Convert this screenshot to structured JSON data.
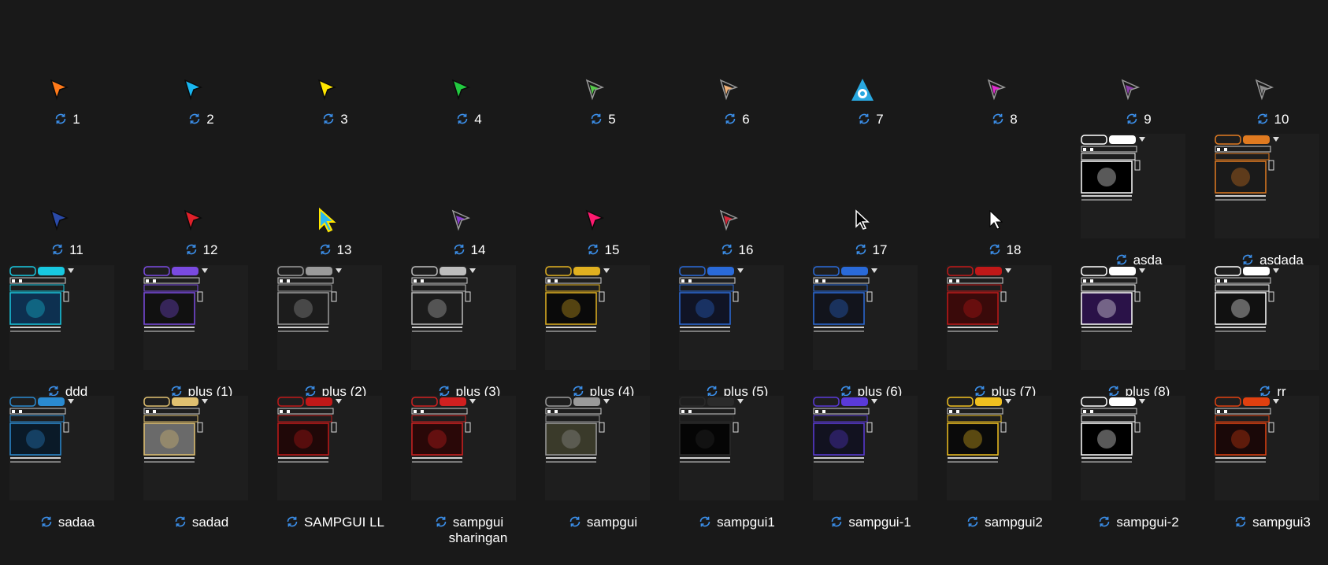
{
  "folder": {
    "cursor_files": [
      {
        "name": "1",
        "icon": "orange-arrow-cursor-icon",
        "color": "#ff7a1a"
      },
      {
        "name": "2",
        "icon": "cyan-arrow-cursor-icon",
        "color": "#19b6f0"
      },
      {
        "name": "3",
        "icon": "yellow-arrow-cursor-icon",
        "color": "#ffe600"
      },
      {
        "name": "4",
        "icon": "green-arrow-cursor-icon",
        "color": "#22c940"
      },
      {
        "name": "5",
        "icon": "green-outline-arrow-cursor-icon",
        "color": "#55c94a"
      },
      {
        "name": "6",
        "icon": "peach-outline-arrow-cursor-icon",
        "color": "#f0b27a"
      },
      {
        "name": "7",
        "icon": "blue-triangle-cursor-icon",
        "color": "#29a8e0"
      },
      {
        "name": "8",
        "icon": "magenta-outline-arrow-cursor-icon",
        "color": "#e02bd0"
      },
      {
        "name": "9",
        "icon": "purple-red-outline-arrow-cursor-icon",
        "color": "#8a3fa8"
      },
      {
        "name": "10",
        "icon": "gray-outline-arrow-cursor-icon",
        "color": "#8c8c8c"
      },
      {
        "name": "11",
        "icon": "navy-arrow-cursor-icon",
        "color": "#2a4aa8"
      },
      {
        "name": "12",
        "icon": "red-arrow-cursor-icon",
        "color": "#e0202a"
      },
      {
        "name": "13",
        "icon": "cyan-yellow-arrow-cursor-icon",
        "color": "#2ab8f0"
      },
      {
        "name": "14",
        "icon": "purple-outline-arrow-cursor-icon",
        "color": "#8a3fd0"
      },
      {
        "name": "15",
        "icon": "pink-arrow-cursor-icon",
        "color": "#ff1a70"
      },
      {
        "name": "16",
        "icon": "red-outline-arrow-cursor-icon",
        "color": "#d8283a"
      },
      {
        "name": "17",
        "icon": "black-arrow-cursor-icon",
        "color": "#000000"
      },
      {
        "name": "18",
        "icon": "white-arrow-cursor-icon",
        "color": "#ffffff"
      }
    ],
    "theme_files": [
      {
        "name": "asda",
        "icon": "eye-of-sauron-thumbnail",
        "accent": "#ffffff",
        "bg": "#000000"
      },
      {
        "name": "asdada",
        "icon": "orange-tiger-thumbnail",
        "accent": "#e07a20",
        "bg": "#1a1a1a"
      },
      {
        "name": "ddd",
        "icon": "cyan-smoke-thumbnail",
        "accent": "#18c8e0",
        "bg": "#0d3050"
      },
      {
        "name": "plus (1)",
        "icon": "purple-theme-thumbnail",
        "accent": "#7a4ae0",
        "bg": "#111111"
      },
      {
        "name": "plus (2)",
        "icon": "gray-theme-thumbnail",
        "accent": "#9a9a9a",
        "bg": "#1c1c1c"
      },
      {
        "name": "plus (3)",
        "icon": "silver-theme-thumbnail",
        "accent": "#bdbdbd",
        "bg": "#1c1c1c"
      },
      {
        "name": "plus (4)",
        "icon": "rockstar-theme-thumbnail",
        "accent": "#e0b020",
        "bg": "#0a0a0a"
      },
      {
        "name": "plus (5)",
        "icon": "blue-theme-thumbnail",
        "accent": "#2a6ad8",
        "bg": "#101425"
      },
      {
        "name": "plus (6)",
        "icon": "blue-dark-theme-thumbnail",
        "accent": "#2a6ad8",
        "bg": "#12141c"
      },
      {
        "name": "plus (7)",
        "icon": "skull-theme-thumbnail",
        "accent": "#c01818",
        "bg": "#3a0a0a"
      },
      {
        "name": "plus (8)",
        "icon": "purple-fighter-thumbnail",
        "accent": "#ffffff",
        "bg": "#2a1248"
      },
      {
        "name": "rr",
        "icon": "punisher-theme-thumbnail",
        "accent": "#ffffff",
        "bg": "#111111"
      },
      {
        "name": "sadaa",
        "icon": "joker-theme-thumbnail",
        "accent": "#2a8ad0",
        "bg": "#0a1a28"
      },
      {
        "name": "sadad",
        "icon": "gold-theme-thumbnail",
        "accent": "#e0c070",
        "bg": "#6a6a6a"
      },
      {
        "name": "SAMPGUI LL",
        "icon": "red-ll-theme-thumbnail",
        "accent": "#c01818",
        "bg": "#200808"
      },
      {
        "name": "sampgui sharingan",
        "icon": "sharingan-theme-thumbnail",
        "accent": "#d02020",
        "bg": "#2a0808"
      },
      {
        "name": "sampgui",
        "icon": "troll-face-theme-thumbnail",
        "accent": "#9a9a9a",
        "bg": "#3a3a2a"
      },
      {
        "name": "sampgui1",
        "icon": "black-car-theme-thumbnail",
        "accent": "#2a2a2a",
        "bg": "#050505"
      },
      {
        "name": "sampgui-1",
        "icon": "purple-blue-theme-thumbnail",
        "accent": "#5a3ad8",
        "bg": "#121220"
      },
      {
        "name": "sampgui2",
        "icon": "yellow-pink-theme-thumbnail",
        "accent": "#f0c020",
        "bg": "#0a0a0a"
      },
      {
        "name": "sampgui-2",
        "icon": "mono-white-theme-thumbnail",
        "accent": "#ffffff",
        "bg": "#000000"
      },
      {
        "name": "sampgui3",
        "icon": "red-orange-theme-thumbnail",
        "accent": "#e04010",
        "bg": "#1a0808"
      }
    ],
    "sync_status_icon": "sync-pending-icon",
    "sync_color": "#3b8ee8"
  }
}
